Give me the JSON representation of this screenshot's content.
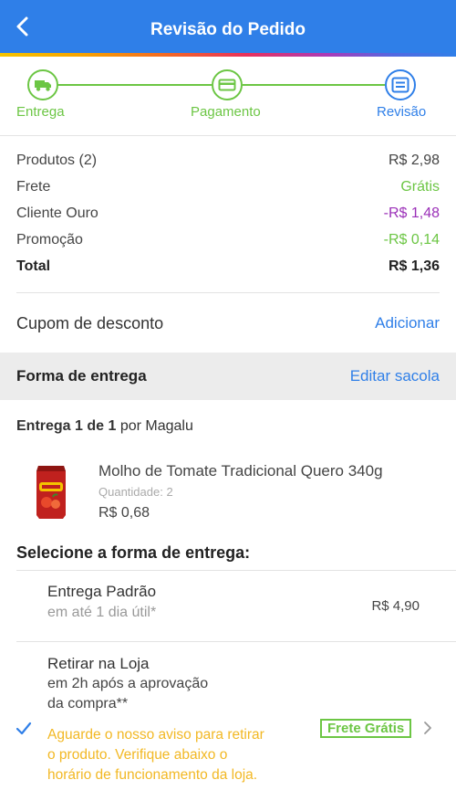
{
  "header": {
    "title": "Revisão do Pedido"
  },
  "colors": {
    "brand_blue": "#2f7fe8",
    "success_green": "#6cc644",
    "gold_purple": "#9b30b8",
    "warning_yellow": "#f2b824"
  },
  "steps": [
    {
      "label": "Entrega",
      "icon": "truck-icon",
      "state": "done"
    },
    {
      "label": "Pagamento",
      "icon": "card-icon",
      "state": "done"
    },
    {
      "label": "Revisão",
      "icon": "list-icon",
      "state": "active"
    }
  ],
  "summary": {
    "rows": [
      {
        "label": "Produtos (2)",
        "value": "R$ 2,98"
      },
      {
        "label": "Frete",
        "value": "Grátis"
      },
      {
        "label": "Cliente Ouro",
        "value": "-R$ 1,48"
      },
      {
        "label": "Promoção",
        "value": "-R$ 0,14"
      },
      {
        "label": "Total",
        "value": "R$ 1,36"
      }
    ]
  },
  "coupon": {
    "label": "Cupom de desconto",
    "action": "Adicionar"
  },
  "shipping_section": {
    "label": "Forma de entrega",
    "action": "Editar sacola"
  },
  "delivery": {
    "title": "Entrega 1 de 1",
    "seller": "por Magalu"
  },
  "product": {
    "name": "Molho de Tomate Tradicional Quero 340g",
    "quantity": "Quantidade: 2",
    "price": "R$ 0,68"
  },
  "select_title": "Selecione a forma de entrega:",
  "options": [
    {
      "title": "Entrega Padrão",
      "subtitle": "em até 1 dia útil*",
      "price": "R$ 4,90",
      "selected": false
    },
    {
      "title": "Retirar na Loja",
      "subtitle_line1": "em 2h após a aprovação",
      "subtitle_line2": "da compra**",
      "warning_line1": "Aguarde o nosso aviso para retirar",
      "warning_line2": "o produto. Verifique abaixo o",
      "warning_line3": "horário de funcionamento da loja.",
      "badge": "Frete Grátis",
      "selected": true
    }
  ]
}
